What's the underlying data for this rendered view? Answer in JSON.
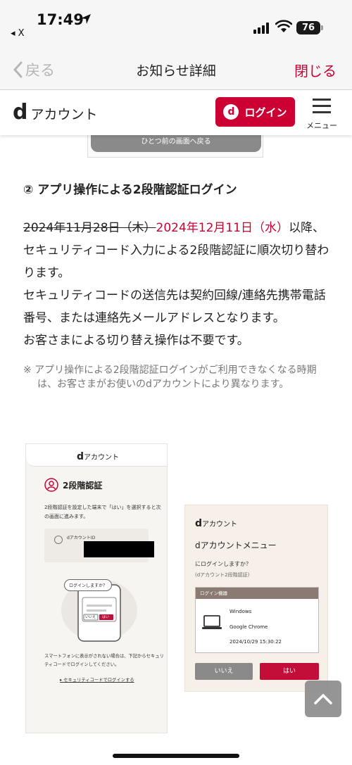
{
  "status_bar": {
    "time": "17:49",
    "back_app": "X",
    "battery": "76"
  },
  "nav": {
    "back_label": "戻る",
    "title": "お知らせ詳細",
    "close_label": "閉じる"
  },
  "header": {
    "logo_d": "d",
    "logo_text": "アカウント",
    "login_badge": "d",
    "login_label": "ログイン",
    "menu_label": "メニュー"
  },
  "content": {
    "prev_button": "ひとつ前の画面へ戻る",
    "heading": "② アプリ操作による2段階認証ログイン",
    "old_date": "2024年11月28日（木）",
    "new_date": "2024年12月11日（水）",
    "para1_tail": "以降、セキュリティコード入力による2段階認証に順次切り替わります。",
    "para2": "セキュリティコードの送信先は契約回線/連絡先携帯電話番号、または連絡先メールアドレスとなります。",
    "para3": "お客さまによる切り替え操作は不要です。",
    "note": "※ アプリ操作による2段階認証ログインがご利用できなくなる時期は、お客さまがお使いのdアカウントにより異なります。"
  },
  "shot_left": {
    "logo_d": "d",
    "logo_text": "アカウント",
    "title": "2段階認証",
    "desc": "2段階認証を設定した端末で「はい」を選択すると次の画面に進みます。",
    "id_label": "dアカウントID",
    "speech": "ログインしますか？",
    "no": "いいえ",
    "yes": "はい",
    "note": "スマートフォンに表示がされない場合は、下記からセキュリティコードでログインしてください。",
    "link": "セキュリティコードでログインする"
  },
  "shot_right": {
    "logo_d": "d",
    "logo_text": "アカウント",
    "title": "dアカウントメニュー",
    "question": "にログインしますか？",
    "sub": "(dアカウント2段階認証)",
    "card_title": "ログイン機器",
    "os": "Windows",
    "browser": "Google Chrome",
    "datetime": "2024/10/29 15:30:22",
    "no": "いいえ",
    "yes": "はい"
  },
  "colors": {
    "brand_red": "#cc0033",
    "gray_button": "#8a8a8a"
  },
  "icons": [
    "location-arrow-icon",
    "signal-icon",
    "wifi-icon",
    "battery-icon",
    "chevron-left-icon",
    "hamburger-menu-icon",
    "person-icon",
    "laptop-icon",
    "chevron-up-icon"
  ]
}
